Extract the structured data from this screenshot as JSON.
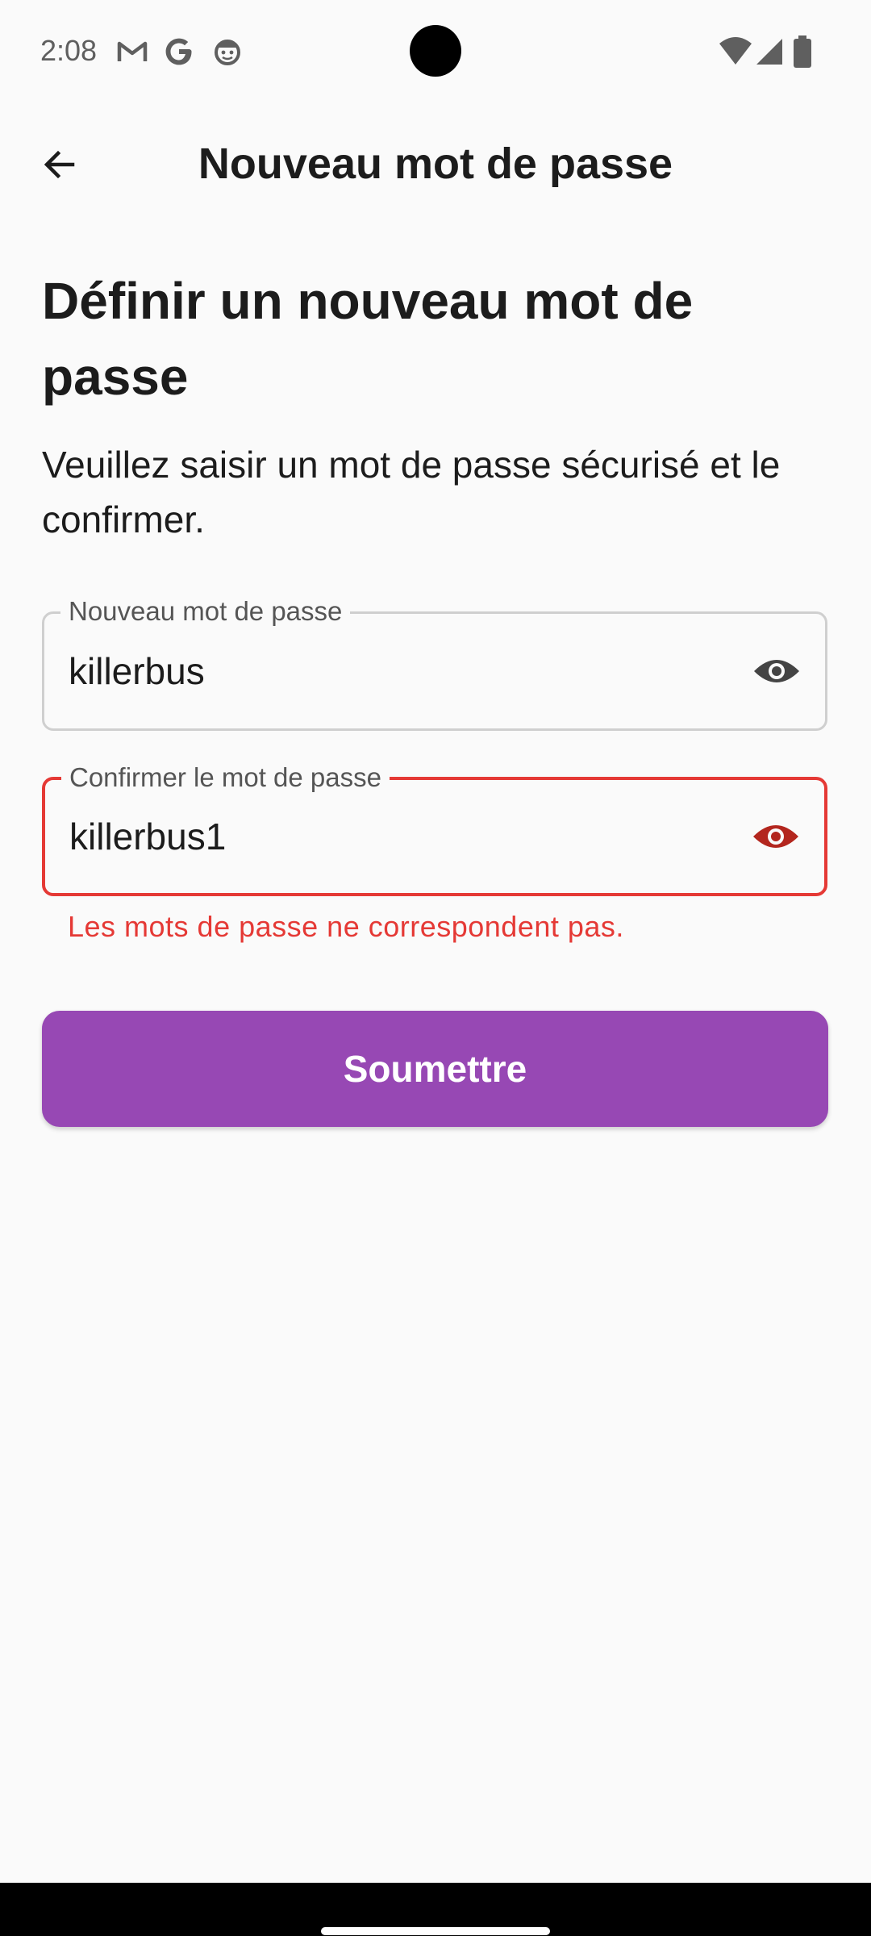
{
  "status_bar": {
    "time": "2:08",
    "left_icons": [
      "gmail-icon",
      "google-icon",
      "face-icon"
    ],
    "right_icons": [
      "wifi-icon",
      "signal-icon",
      "battery-icon"
    ]
  },
  "app_bar": {
    "title": "Nouveau mot de passe",
    "back_icon": "arrow-back-icon"
  },
  "content": {
    "heading": "Définir un nouveau mot de passe",
    "subtitle": "Veuillez saisir un mot de passe sécurisé et le confirmer."
  },
  "form": {
    "new_password": {
      "label": "Nouveau mot de passe",
      "value": "killerbus",
      "icon": "eye-icon",
      "icon_color": "#444444"
    },
    "confirm_password": {
      "label": "Confirmer le mot de passe",
      "value": "killerbus1",
      "icon": "eye-icon",
      "icon_color": "#b3261e",
      "error": "Les mots de passe ne correspondent pas."
    },
    "submit_label": "Soumettre"
  },
  "colors": {
    "accent": "#9748b4",
    "error": "#e53935",
    "background": "#fafafa"
  }
}
